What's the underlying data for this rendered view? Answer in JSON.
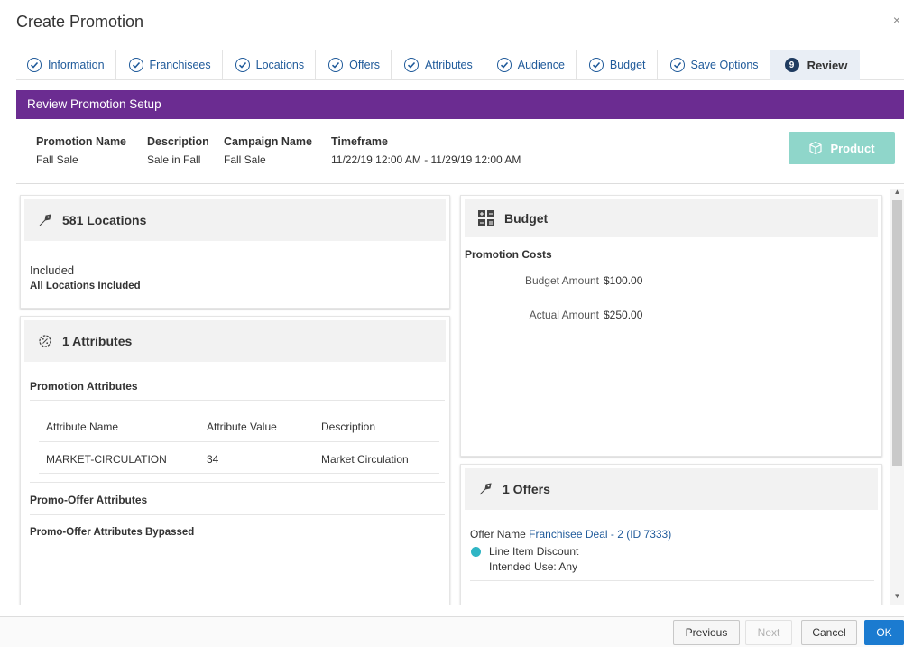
{
  "dialog": {
    "title": "Create Promotion",
    "close": "×"
  },
  "steps": [
    {
      "label": "Information"
    },
    {
      "label": "Franchisees"
    },
    {
      "label": "Locations"
    },
    {
      "label": "Offers"
    },
    {
      "label": "Attributes"
    },
    {
      "label": "Audience"
    },
    {
      "label": "Budget"
    },
    {
      "label": "Save Options"
    },
    {
      "label": "Review",
      "number": "9",
      "active": true
    }
  ],
  "review_bar": {
    "title": "Review Promotion Setup"
  },
  "summary": {
    "promotion_name": {
      "label": "Promotion Name",
      "value": "Fall Sale"
    },
    "description": {
      "label": "Description",
      "value": "Sale in Fall"
    },
    "campaign_name": {
      "label": "Campaign Name",
      "value": "Fall Sale"
    },
    "timeframe": {
      "label": "Timeframe",
      "value": "11/22/19 12:00 AM - 11/29/19 12:00 AM"
    },
    "product_button": "Product"
  },
  "locations_panel": {
    "title": "581 Locations",
    "status": "Included",
    "detail": "All Locations Included"
  },
  "attributes_panel": {
    "title": "1 Attributes",
    "promotion_attributes_heading": "Promotion Attributes",
    "columns": [
      "Attribute Name",
      "Attribute Value",
      "Description"
    ],
    "rows": [
      {
        "name": "MARKET-CIRCULATION",
        "value": "34",
        "description": "Market Circulation"
      }
    ],
    "promo_offer_heading": "Promo-Offer Attributes",
    "promo_offer_text": "Promo-Offer Attributes Bypassed"
  },
  "budget_panel": {
    "title": "Budget",
    "costs_heading": "Promotion Costs",
    "budget_label": "Budget Amount",
    "budget_value": "$100.00",
    "actual_label": "Actual Amount",
    "actual_value": "$250.00"
  },
  "offers_panel": {
    "title": "1 Offers",
    "offer_name_label": "Offer Name",
    "offer_name_value": "Franchisee Deal - 2 (ID 7333)",
    "offer_type": "Line Item Discount",
    "intended_use": "Intended Use: Any"
  },
  "footer": {
    "previous": "Previous",
    "next": "Next",
    "cancel": "Cancel",
    "ok": "OK"
  },
  "colors": {
    "review_bar": "#6b2c91",
    "product_button": "#8fd6ca",
    "offer_dot": "#2fb5c4",
    "primary": "#1b7bd0"
  }
}
